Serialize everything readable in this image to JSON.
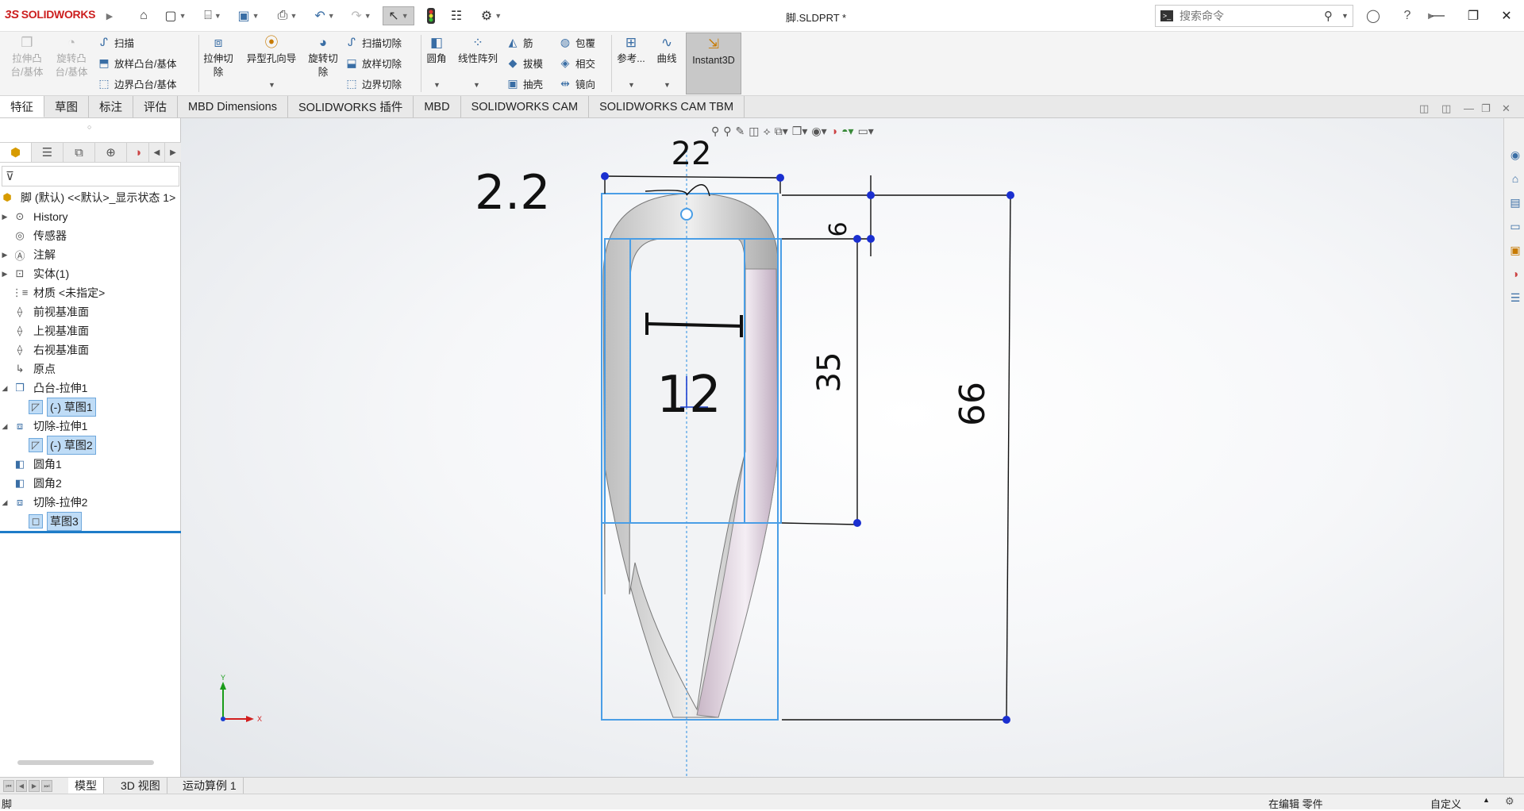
{
  "title_bar": {
    "logo": "SOLIDWORKS",
    "logo_mark": "3S",
    "document_title": "脚.SLDPRT *",
    "search_placeholder": "搜索命令"
  },
  "command_manager": {
    "extrude_boss": "拉伸凸\n台/基体",
    "revolve_boss": "旋转凸\n台/基体",
    "sweep": "扫描",
    "loft_boss": "放样凸台/基体",
    "boundary_boss": "边界凸台/基体",
    "extrude_cut": "拉伸切\n除",
    "hole_wizard": "异型孔向导",
    "revolve_cut": "旋转切\n除",
    "swept_cut": "扫描切除",
    "lofted_cut": "放样切除",
    "boundary_cut": "边界切除",
    "fillet": "圆角",
    "linear_pattern": "线性阵列",
    "rib": "筋",
    "draft": "拔模",
    "shell": "抽壳",
    "wrap": "包覆",
    "intersect": "相交",
    "mirror": "镜向",
    "reference": "参考...",
    "curves": "曲线",
    "instant3d": "Instant3D"
  },
  "tabs": [
    "特征",
    "草图",
    "标注",
    "评估",
    "MBD Dimensions",
    "SOLIDWORKS 插件",
    "MBD",
    "SOLIDWORKS CAM",
    "SOLIDWORKS CAM TBM"
  ],
  "feature_tree": {
    "root": "脚 (默认) <<默认>_显示状态 1>",
    "items": [
      {
        "label": "History"
      },
      {
        "label": "传感器"
      },
      {
        "label": "注解"
      },
      {
        "label": "实体(1)"
      },
      {
        "label": "材质 <未指定>"
      },
      {
        "label": "前视基准面"
      },
      {
        "label": "上视基准面"
      },
      {
        "label": "右视基准面"
      },
      {
        "label": "原点"
      },
      {
        "label": "凸台-拉伸1"
      },
      {
        "label": "(-) 草图1"
      },
      {
        "label": "切除-拉伸1"
      },
      {
        "label": "(-) 草图2"
      },
      {
        "label": "圆角1"
      },
      {
        "label": "圆角2"
      },
      {
        "label": "切除-拉伸2"
      },
      {
        "label": "草图3"
      }
    ]
  },
  "drawing": {
    "dim_width": "22",
    "dim_radius_note": "2.2",
    "dim_inner_width": "12",
    "dim_top": "6",
    "dim_mid": "35",
    "dim_total": "66"
  },
  "triad": {
    "x": "X",
    "y": "Y"
  },
  "bottom_tabs": [
    "模型",
    "3D 视图",
    "运动算例 1"
  ],
  "status_bar": {
    "left": "脚",
    "mode": "在编辑 零件",
    "units": "自定义"
  },
  "colors": {
    "brand_red": "#cc1f1f",
    "sketch_blue": "#1e7cc8",
    "selection_fill": "#bfdcf6",
    "dimension_black": "#111111"
  }
}
